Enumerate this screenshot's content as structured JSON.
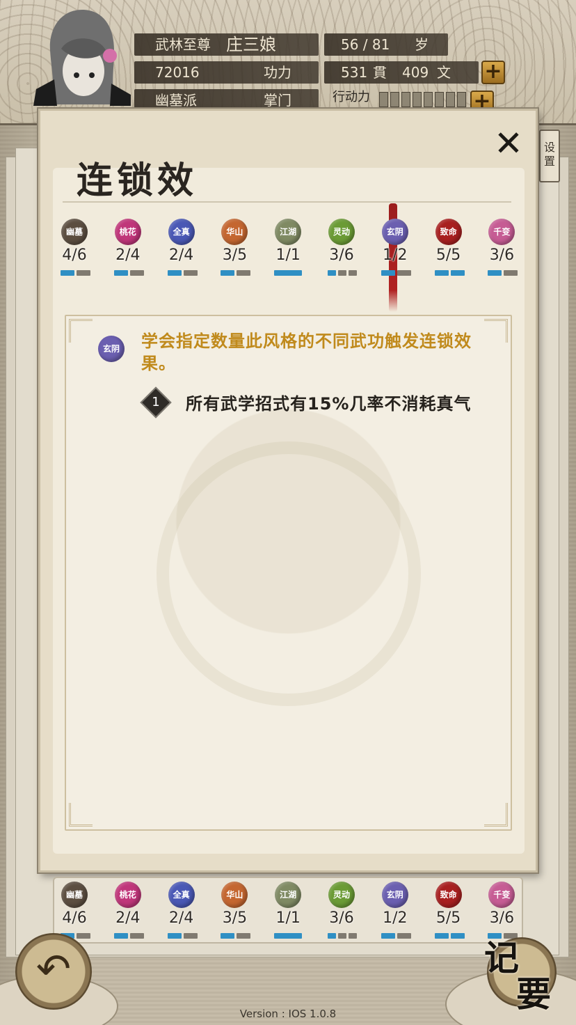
{
  "header": {
    "rank_title": "武林至尊",
    "character_name": "庄三娘",
    "age_value": "56 / 81",
    "age_unit": "岁",
    "power_value": "72016",
    "power_label": "功力",
    "money_guan": "531",
    "money_guan_unit": "貫",
    "money_wen": "409",
    "money_wen_unit": "文",
    "faction": "幽墓派",
    "position": "掌门",
    "action_label": "行动力",
    "plus_icon": "plus-icon"
  },
  "dialog": {
    "title": "连锁效",
    "close_icon": "close-icon"
  },
  "settings_tag": "设置",
  "chain_styles": [
    {
      "name": "幽墓",
      "count": "4/6",
      "color": "#5c4e40",
      "filled": 1,
      "segments": 2
    },
    {
      "name": "桃花",
      "count": "2/4",
      "color": "#c0367a",
      "filled": 1,
      "segments": 2
    },
    {
      "name": "全真",
      "count": "2/4",
      "color": "#4a58b5",
      "filled": 1,
      "segments": 2
    },
    {
      "name": "华山",
      "count": "3/5",
      "color": "#c46630",
      "filled": 1,
      "segments": 2
    },
    {
      "name": "江湖",
      "count": "1/1",
      "color": "#7f8a63",
      "filled": 1,
      "segments": 1
    },
    {
      "name": "灵动",
      "count": "3/6",
      "color": "#6b9b35",
      "filled": 1,
      "segments": 3
    },
    {
      "name": "玄阴",
      "count": "1/2",
      "color": "#6b5fb0",
      "filled": 1,
      "segments": 2
    },
    {
      "name": "致命",
      "count": "5/5",
      "color": "#a82020",
      "filled": 2,
      "segments": 2
    },
    {
      "name": "千变",
      "count": "3/6",
      "color": "#c65c94",
      "filled": 1,
      "segments": 2
    }
  ],
  "detail": {
    "badge": "玄阴",
    "description": "学会指定数量此风格的不同武功触发连锁效果。",
    "effects": [
      {
        "number": "1",
        "text": "所有武学招式有15%几率不消耗真气"
      }
    ]
  },
  "bottom": {
    "back_icon": "back-arrow-icon",
    "notes_char1": "记",
    "notes_char2": "要"
  },
  "version": "Version : IOS 1.0.8"
}
